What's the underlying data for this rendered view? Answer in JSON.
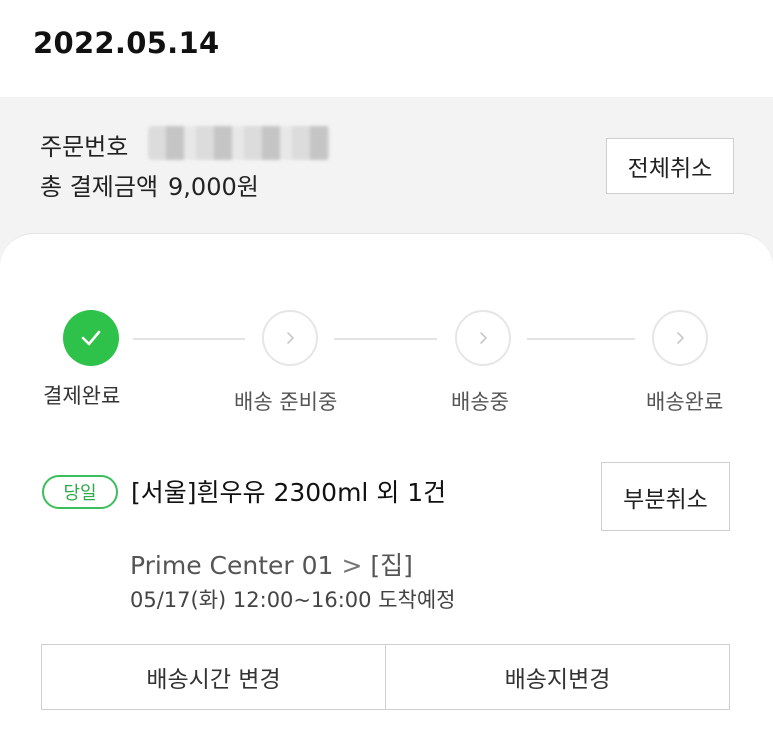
{
  "order_date": "2022.05.14",
  "summary": {
    "order_number_label": "주문번호",
    "total_amount_label": "총 결제금액",
    "total_amount_value": "9,000원",
    "cancel_all_label": "전체취소"
  },
  "progress": {
    "steps": [
      {
        "label": "결제완료",
        "status": "done",
        "icon": "check-icon"
      },
      {
        "label": "배송 준비중",
        "status": "pending",
        "icon": "chevron-right-icon"
      },
      {
        "label": "배송중",
        "status": "pending",
        "icon": "chevron-right-icon"
      },
      {
        "label": "배송완료",
        "status": "pending",
        "icon": "chevron-right-icon"
      }
    ]
  },
  "item": {
    "badge": "당일",
    "title": "[서울]흰우유 2300ml 외 1건",
    "partial_cancel_label": "부분취소",
    "origin": "Prime Center 01",
    "destination": "[집]",
    "eta": "05/17(화) 12:00~16:00 도착예정"
  },
  "actions": {
    "change_time_label": "배송시간 변경",
    "change_address_label": "배송지변경"
  },
  "colors": {
    "accent_green": "#2fc24a",
    "badge_green": "#3cbf5a",
    "background_gray": "#f3f3f3"
  }
}
